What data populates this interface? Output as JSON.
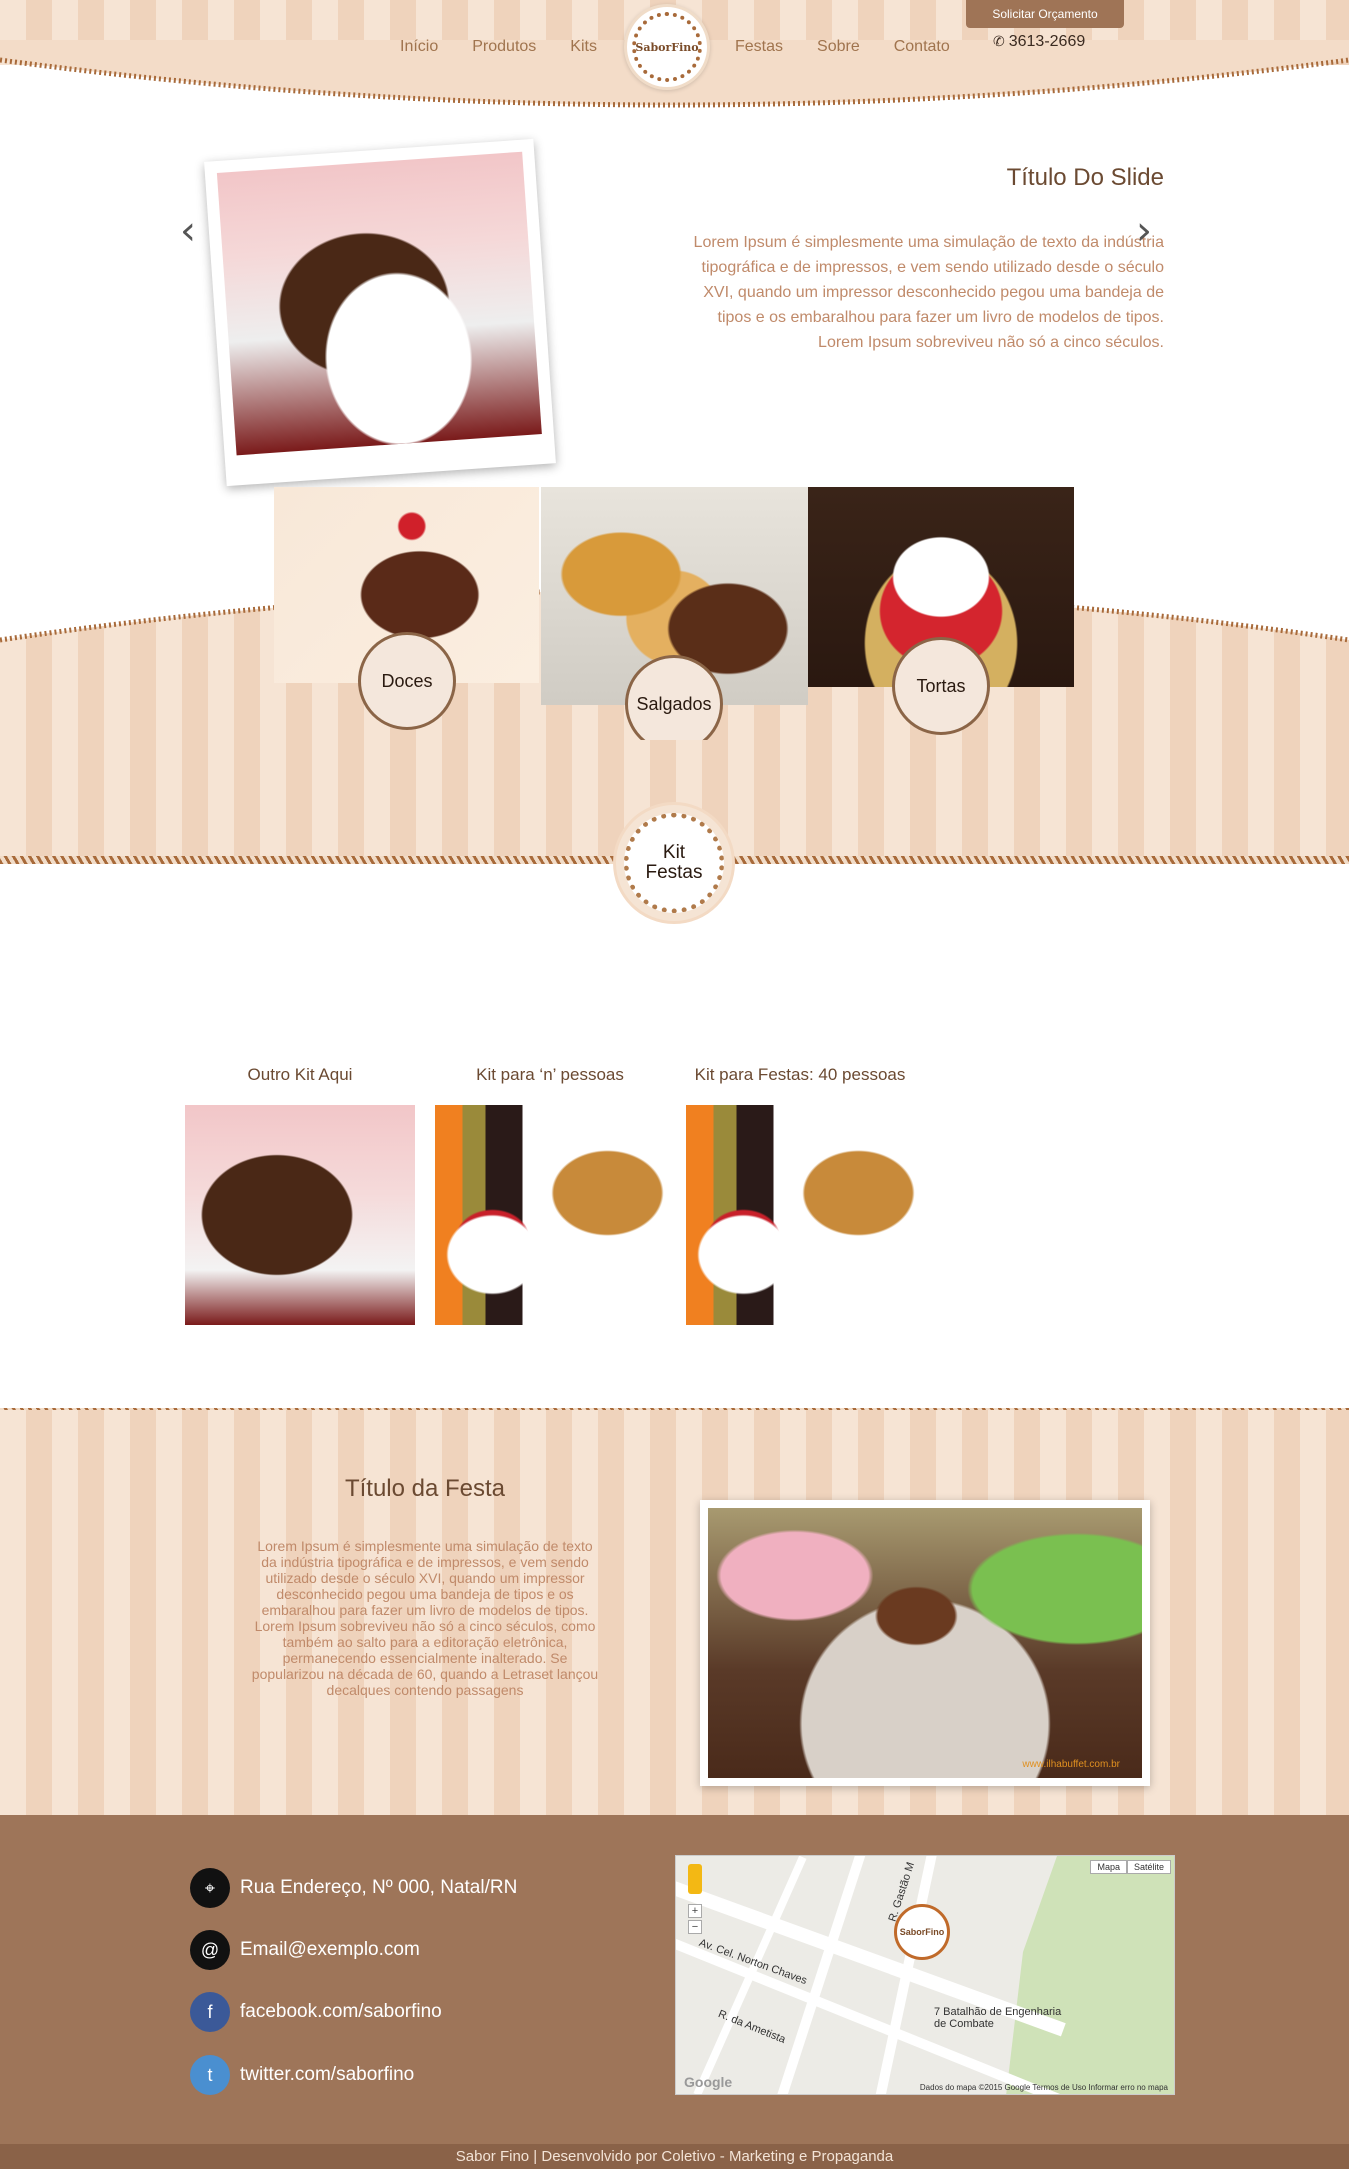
{
  "header": {
    "nav_left": [
      "Início",
      "Produtos",
      "Kits"
    ],
    "nav_right": [
      "Festas",
      "Sobre",
      "Contato"
    ],
    "logo_text": "SaborFino",
    "quote_button": "Solicitar Orçamento",
    "phone_icon": "phone-icon",
    "phone": "3613-2669"
  },
  "slider": {
    "title": "Título Do Slide",
    "text": "Lorem Ipsum é simplesmente uma simulação de texto da indústria tipográfica e de impressos, e vem sendo utilizado desde o século XVI, quando um impressor desconhecido pegou uma bandeja de tipos e os embaralhou para fazer um livro de modelos de tipos. Lorem Ipsum sobreviveu não só a cinco séculos.",
    "prev": "‹",
    "next": "›"
  },
  "categories": [
    {
      "label": "Doces"
    },
    {
      "label": "Salgados"
    },
    {
      "label": "Tortas"
    }
  ],
  "kit_badge": {
    "line1": "Kit",
    "line2": "Festas"
  },
  "kits": [
    {
      "title": "Outro Kit Aqui"
    },
    {
      "title": "Kit para ‘n’ pessoas"
    },
    {
      "title": "Kit para Festas: 40 pessoas"
    }
  ],
  "festa": {
    "title": "Título da Festa",
    "text": "Lorem Ipsum é simplesmente uma simulação de texto da indústria tipográfica e de impressos, e vem sendo utilizado desde o século XVI, quando um impressor desconhecido pegou uma bandeja de tipos e os embaralhou para fazer um livro de modelos de tipos. Lorem Ipsum sobreviveu não só a cinco séculos, como também ao salto para a editoração eletrônica, permanecendo essencialmente inalterado. Se popularizou na década de 60, quando a Letraset lançou decalques contendo passagens",
    "watermark": "www.ilhabuffet.com.br"
  },
  "footer": {
    "address": "Rua Endereço, Nº 000, Natal/RN",
    "email": "Email@exemplo.com",
    "facebook": "facebook.com/saborfino",
    "twitter": "twitter.com/saborfino",
    "icons": {
      "address": "location-pin-icon",
      "email": "at-icon",
      "facebook": "facebook-icon",
      "twitter": "twitter-icon"
    }
  },
  "map": {
    "type_map": "Mapa",
    "type_satellite": "Satélite",
    "street1": "Av. Cel. Norton Chaves",
    "street2": "R. da Ametista",
    "street3": "R. Gastão M",
    "place": "7 Batalhão de Engenharia de Combate",
    "marker": "SaborFino",
    "google": "Google",
    "credits": "Dados do mapa ©2015 Google   Termos de Uso   Informar erro no mapa",
    "zoom_in": "+",
    "zoom_out": "−"
  },
  "copyright": "Sabor Fino | Desenvolvido por Coletivo - Marketing e Propaganda",
  "colors": {
    "stripe_light": "#f6e4d4",
    "stripe_dark": "#efd3bc",
    "footer": "#9e7559",
    "accent": "#a86a3a"
  }
}
